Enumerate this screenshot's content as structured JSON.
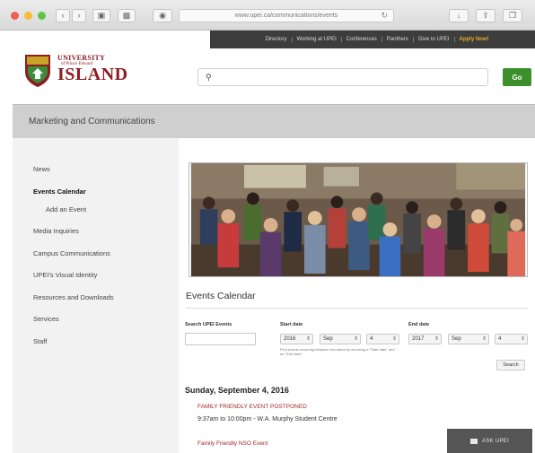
{
  "browser": {
    "url": "www.upei.ca/communications/events",
    "traffic_light_colors": [
      "#ee5f58",
      "#f8bc3b",
      "#5ec445"
    ]
  },
  "top_nav": {
    "items": [
      "Directory",
      "Working at UPEI",
      "Conferences",
      "Panthers",
      "Give to UPEI",
      "Apply Now!"
    ],
    "accent_color": "#e8a52a"
  },
  "logo": {
    "line1": "UNIVERSITY",
    "line2": "of Prince Edward",
    "line3": "ISLAND",
    "brand_color": "#8c1d22"
  },
  "site_search": {
    "placeholder": "",
    "button_label": "Go",
    "button_color": "#3d8f2c"
  },
  "section_title": "Marketing and Communications",
  "sidebar": {
    "items": [
      {
        "label": "News"
      },
      {
        "label": "Events Calendar",
        "active": true
      },
      {
        "label": "Add an Event",
        "sub": true
      },
      {
        "label": "Media Inquiries"
      },
      {
        "label": "Campus Communications"
      },
      {
        "label": "UPEI's Visual Identity"
      },
      {
        "label": "Resources and Downloads"
      },
      {
        "label": "Services"
      },
      {
        "label": "Staff"
      }
    ]
  },
  "main": {
    "title": "Events Calendar",
    "hero_image": "crowd-photo",
    "filters": {
      "search_label": "Search UPEI Events",
      "search_value": "",
      "start_label": "Start date",
      "end_label": "End date",
      "start": {
        "year": "2016",
        "month": "Sep",
        "day": "4"
      },
      "end": {
        "year": "2017",
        "month": "Sep",
        "day": "4"
      },
      "hint": "Find events occurring between two dates by choosing a \"Start date\" and an \"End date\".",
      "search_button": "Search"
    },
    "day_heading": "Sunday, September 4, 2016",
    "events": [
      {
        "title": "FAMILY FRIENDLY EVENT POSTPONED",
        "meta": "9:37am to 10:00pm - W.A. Murphy Student Centre"
      },
      {
        "title": "Family Friendly NSO Event",
        "meta": ""
      }
    ]
  },
  "ask_button": {
    "label": "ASK UPEI"
  }
}
